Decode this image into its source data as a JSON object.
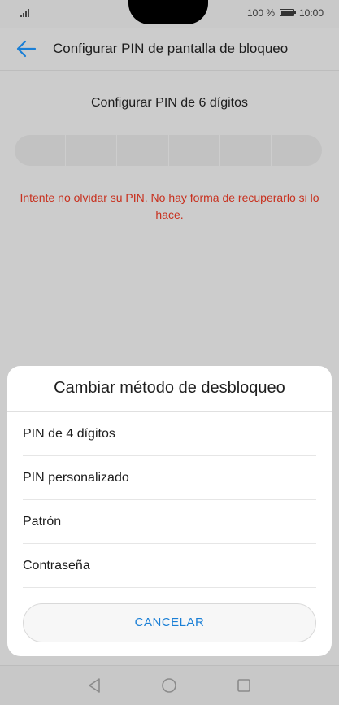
{
  "status_bar": {
    "battery_percent": "100 %",
    "time": "10:00",
    "icons": [
      "signal-icon",
      "battery-icon"
    ]
  },
  "app_bar": {
    "title": "Configurar PIN de pantalla de bloqueo",
    "back_icon": "back-arrow-icon",
    "accent": "#1a7fd6"
  },
  "pin_setup": {
    "heading": "Configurar PIN de 6 dígitos",
    "digits": 6,
    "warning": "Intente no olvidar su PIN. No hay forma de recuperarlo si lo hace.",
    "warning_color": "#c8311f"
  },
  "dialog": {
    "title": "Cambiar método de desbloqueo",
    "options": [
      {
        "label": "PIN de 4 dígitos"
      },
      {
        "label": "PIN personalizado"
      },
      {
        "label": "Patrón"
      },
      {
        "label": "Contraseña"
      }
    ],
    "cancel_label": "CANCELAR"
  },
  "nav_bar": {
    "icons": [
      "back-triangle-icon",
      "home-circle-icon",
      "recents-square-icon"
    ]
  }
}
